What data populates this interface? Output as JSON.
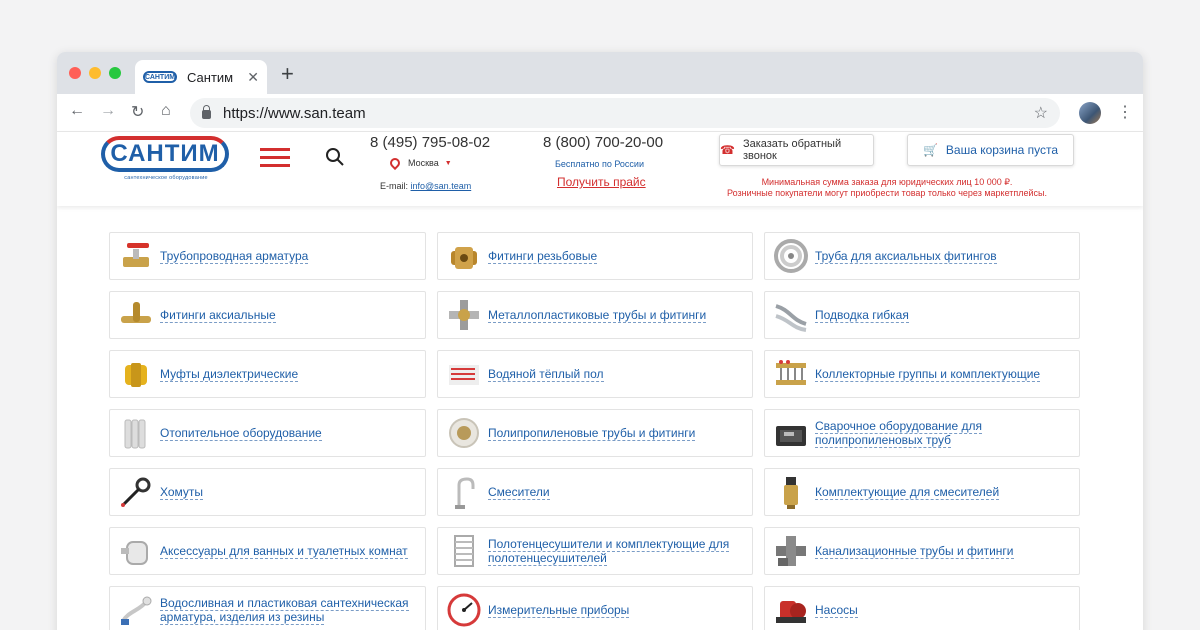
{
  "browser": {
    "tab_title": "Сантим",
    "tab_favicon_text": "САНТИМ",
    "url": "https://www.san.team"
  },
  "header": {
    "logo_text": "САНТИМ",
    "logo_subtitle": "сантехническое оборудование",
    "phone_main": "8 (495) 795-08-02",
    "city": "Москва",
    "email_label": "E-mail:",
    "email": "info@san.team",
    "phone_free": "8 (800) 700-20-00",
    "free_note": "Бесплатно по России",
    "price_link": "Получить прайс",
    "callback_button": "Заказать обратный звонок",
    "cart_button": "Ваша корзина пуста",
    "notice_line1": "Минимальная сумма заказа для юридических лиц 10 000 ₽.",
    "notice_line2": "Розничные покупатели могут приобрести товар только через маркетплейсы."
  },
  "colors": {
    "brand_blue": "#1f5fa8",
    "brand_red": "#d32f2f"
  },
  "categories": [
    {
      "label": "Трубопроводная арматура",
      "icon": "ball-valve-icon"
    },
    {
      "label": "Фитинги резьбовые",
      "icon": "threaded-fitting-icon"
    },
    {
      "label": "Труба для аксиальных фитингов",
      "icon": "pipe-coil-icon"
    },
    {
      "label": "Фитинги аксиальные",
      "icon": "axial-fitting-icon"
    },
    {
      "label": "Металлопластиковые трубы и фитинги",
      "icon": "cross-fitting-icon"
    },
    {
      "label": "Подводка гибкая",
      "icon": "flexible-hose-icon"
    },
    {
      "label": "Муфты диэлектрические",
      "icon": "dielectric-coupling-icon"
    },
    {
      "label": "Водяной тёплый пол",
      "icon": "floor-heating-icon"
    },
    {
      "label": "Коллекторные группы и комплектующие",
      "icon": "manifold-icon"
    },
    {
      "label": "Отопительное оборудование",
      "icon": "radiator-icon"
    },
    {
      "label": "Полипропиленовые трубы и фитинги",
      "icon": "pp-fitting-icon"
    },
    {
      "label": "Сварочное оборудование для полипропиленовых труб",
      "icon": "welding-kit-icon"
    },
    {
      "label": "Хомуты",
      "icon": "clamp-icon"
    },
    {
      "label": "Смесители",
      "icon": "faucet-icon"
    },
    {
      "label": "Комплектующие для смесителей",
      "icon": "cartridge-icon"
    },
    {
      "label": "Аксессуары для ванных и туалетных комнат",
      "icon": "bath-accessory-icon"
    },
    {
      "label": "Полотенцесушители и комплектующие для полотенцесушителей",
      "icon": "towel-rail-icon"
    },
    {
      "label": "Канализационные трубы и фитинги",
      "icon": "sewer-pipe-icon"
    },
    {
      "label": "Водосливная и пластиковая сантехническая арматура, изделия из резины",
      "icon": "drain-fitting-icon"
    },
    {
      "label": "Измерительные приборы",
      "icon": "gauge-icon"
    },
    {
      "label": "Насосы",
      "icon": "pump-icon"
    }
  ]
}
